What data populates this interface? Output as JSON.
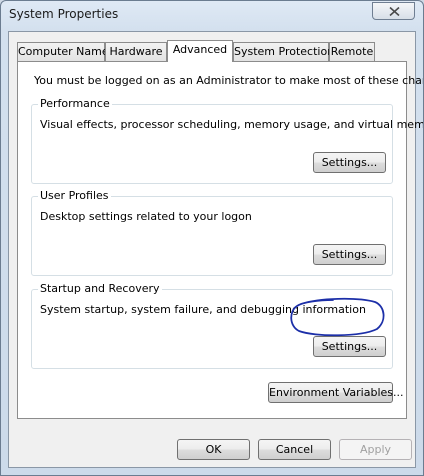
{
  "window": {
    "title": "System Properties"
  },
  "tabs": [
    {
      "label": "Computer Name"
    },
    {
      "label": "Hardware"
    },
    {
      "label": "Advanced"
    },
    {
      "label": "System Protection"
    },
    {
      "label": "Remote"
    }
  ],
  "active_tab": "Advanced",
  "admin_note": "You must be logged on as an Administrator to make most of these changes.",
  "groups": {
    "performance": {
      "title": "Performance",
      "description": "Visual effects, processor scheduling, memory usage, and virtual memory",
      "button": "Settings..."
    },
    "user_profiles": {
      "title": "User Profiles",
      "description": "Desktop settings related to your logon",
      "button": "Settings..."
    },
    "startup_recovery": {
      "title": "Startup and Recovery",
      "description": "System startup, system failure, and debugging information",
      "button": "Settings..."
    }
  },
  "env_button": "Environment Variables...",
  "footer": {
    "ok": "OK",
    "cancel": "Cancel",
    "apply": "Apply"
  },
  "colors": {
    "annotation": "#1c2fa8"
  }
}
